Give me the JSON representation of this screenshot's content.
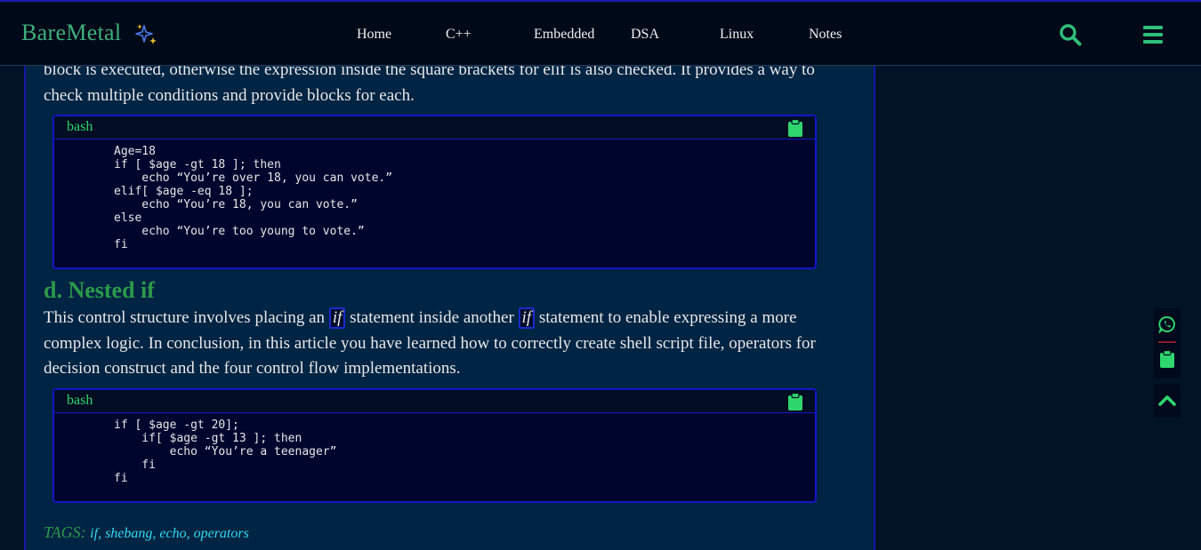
{
  "header": {
    "logo": "BareMetal",
    "nav": [
      "Home",
      "C++",
      "Embedded",
      "DSA",
      "Linux",
      "Notes"
    ]
  },
  "colors": {
    "accent": "#2fd66e",
    "link": "#38d8ec",
    "header_bg": "#000918"
  },
  "article": {
    "para_top": "block is executed, otherwise the expression inside the square brackets for elif is also checked. It provides a way to check multiple conditions and provide blocks for each.",
    "code1": {
      "lang": "bash",
      "code": "Age=18\nif [ $age -gt 18 ]; then\n    echo “You’re over 18, you can vote.”\nelif[ $age -eq 18 ];\n    echo “You’re 18, you can vote.”\nelse\n    echo “You’re too young to vote.”\nfi"
    },
    "heading": "d. Nested if",
    "para2": {
      "p1": "This control structure involves placing an ",
      "code_a": "if",
      "p2": " statement inside another ",
      "code_b": "if",
      "p3": " statement to enable expressing a more complex logic. In conclusion, in this article you have learned how to correctly create shell script file, operators for decision construct and the four control flow implementations."
    },
    "code2": {
      "lang": "bash",
      "code": "if [ $age -gt 20];\n    if[ $age -gt 13 ]; then\n        echo “You’re a teenager”\n    fi\nfi"
    },
    "tags": {
      "label": "TAGS:",
      "items": [
        "if",
        "shebang",
        "echo",
        "operators"
      ],
      "sep": ", "
    }
  },
  "icons": {
    "logo": "sparkles-icon",
    "search": "search-icon",
    "menu": "hamburger-menu-icon",
    "copy": "clipboard-icon",
    "share": "whatsapp-icon",
    "to_top": "chevron-up-icon"
  }
}
